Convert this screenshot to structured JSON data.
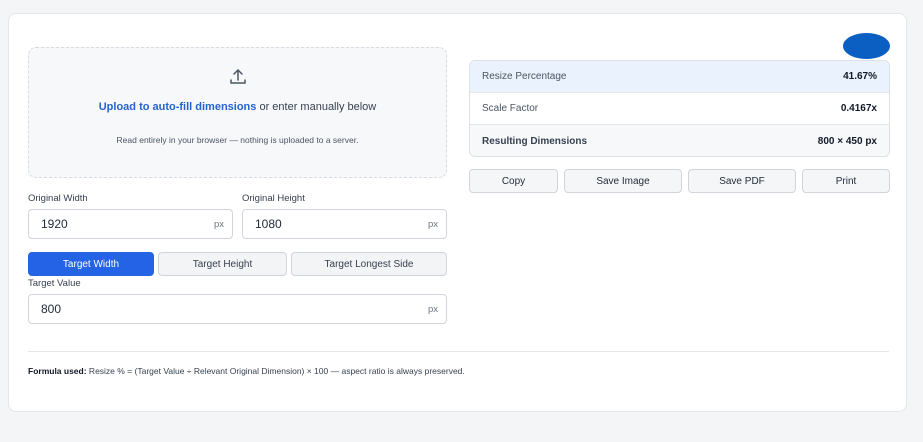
{
  "upload": {
    "icon": "upload-icon",
    "link_text": "Upload to auto-fill dimensions",
    "rest_text": " or enter manually below",
    "note": "Read entirely in your browser — nothing is uploaded to a server."
  },
  "original": {
    "width_label": "Original Width",
    "width_value": "1920",
    "height_label": "Original Height",
    "height_value": "1080",
    "unit": "px"
  },
  "modes": [
    {
      "label": "Target Width",
      "active": true
    },
    {
      "label": "Target Height",
      "active": false
    },
    {
      "label": "Target Longest Side",
      "active": false
    }
  ],
  "target": {
    "label": "Target Value",
    "value": "800",
    "unit": "px"
  },
  "results": [
    {
      "label": "Resize Percentage",
      "value": "41.67%"
    },
    {
      "label": "Scale Factor",
      "value": "0.4167x"
    },
    {
      "label": "Resulting Dimensions",
      "value": "800 × 450 px"
    }
  ],
  "actions": [
    "Copy",
    "Save Image",
    "Save PDF",
    "Print"
  ],
  "formula": {
    "prefix": "Formula used:",
    "text": " Resize % = (Target Value ÷ Relevant Original Dimension) × 100 — aspect ratio is always preserved."
  },
  "colors": {
    "accent": "#2463e5",
    "link": "#2463d0",
    "avatar": "#0b5fc2",
    "highlight_row": "#eaf2fd"
  }
}
